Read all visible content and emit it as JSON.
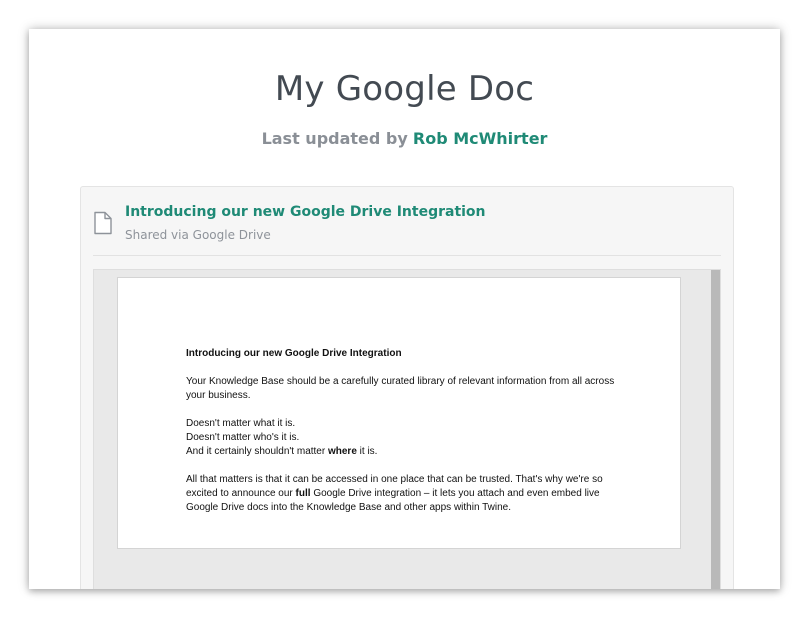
{
  "page": {
    "title": "My Google Doc",
    "updated_prefix": "Last updated by",
    "author": "Rob McWhirter"
  },
  "attachment": {
    "icon": "file-icon",
    "title": "Introducing our new Google Drive Integration",
    "subtitle": "Shared via Google Drive"
  },
  "document": {
    "heading": "Introducing our new Google Drive Integration",
    "para1": "Your Knowledge Base should be a carefully curated library of relevant information from all across your business.",
    "line1": "Doesn't matter what it is.",
    "line2": "Doesn't matter who's it is.",
    "line3_before": "And it certainly shouldn't matter",
    "line3_bold": "where",
    "line3_after": "it is.",
    "para3_before": "All that matters is that it can be accessed in one place that can be trusted. That's why we're so excited to announce our",
    "para3_bold": "full",
    "para3_after": "Google Drive integration – it lets you attach and even embed live Google Drive docs into the Knowledge Base and other apps within Twine."
  },
  "colors": {
    "accent": "#1f8a76",
    "title": "#434a52",
    "muted": "#8a8f96"
  }
}
